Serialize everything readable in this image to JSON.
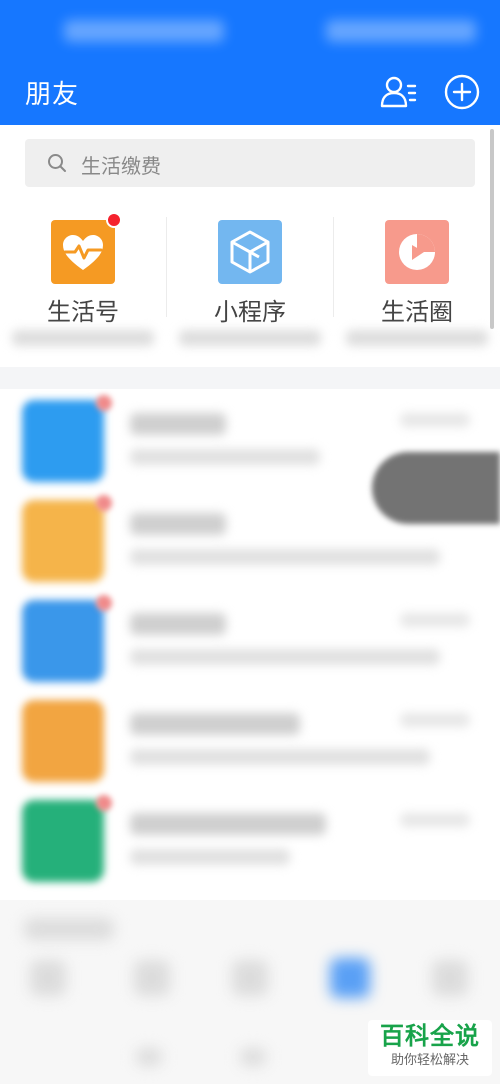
{
  "header": {
    "title": "朋友",
    "contacts_icon": "contacts-icon",
    "add_icon": "add-circle-icon"
  },
  "search": {
    "placeholder": "生活缴费",
    "icon": "search-icon"
  },
  "shortcuts": [
    {
      "label": "生活号",
      "icon": "heart-pulse-icon",
      "color": "#f59a23",
      "has_badge": true
    },
    {
      "label": "小程序",
      "icon": "hexagon-cube-icon",
      "color": "#73b7f0",
      "has_badge": false
    },
    {
      "label": "生活圈",
      "icon": "play-circle-icon",
      "color": "#f79a8c",
      "has_badge": false
    }
  ],
  "colors": {
    "brand_blue": "#1677ff",
    "badge_red": "#f5222d",
    "watermark_green": "#18a34a"
  },
  "watermark": {
    "brand": "百科全说",
    "tagline": "助你轻松解决"
  }
}
